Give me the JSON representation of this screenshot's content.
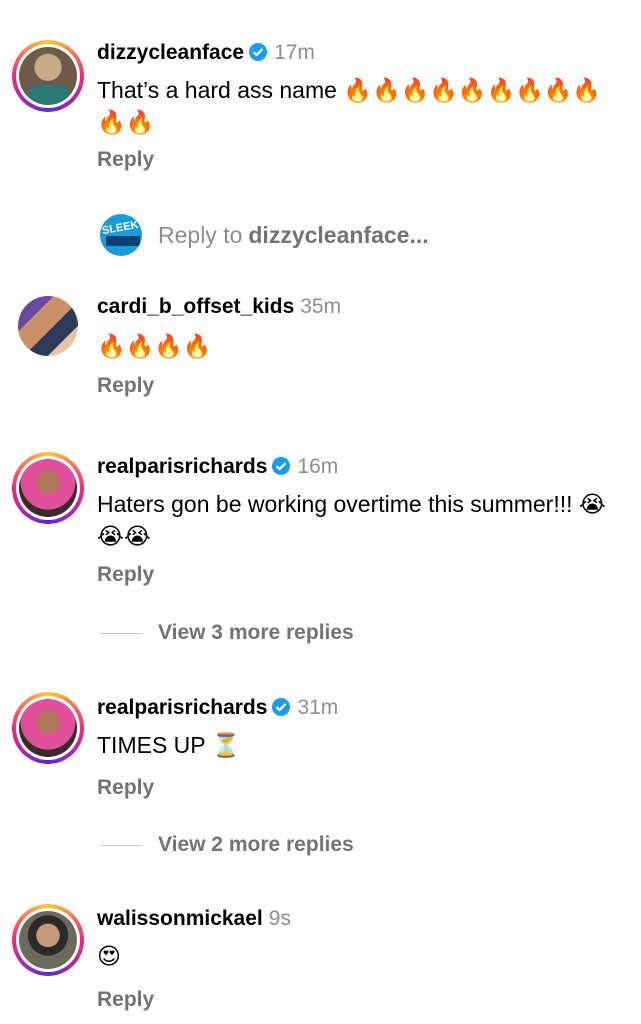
{
  "comments": [
    {
      "username": "dizzycleanface",
      "verified": true,
      "time": "17m",
      "text": "That’s a hard ass name 🔥🔥🔥🔥🔥🔥🔥🔥🔥🔥🔥",
      "reply": "Reply"
    },
    {
      "username": "cardi_b_offset_kids",
      "verified": false,
      "time": "35m",
      "text": "🔥🔥🔥🔥",
      "reply": "Reply"
    },
    {
      "username": "realparisrichards",
      "verified": true,
      "time": "16m",
      "text": "Haters gon be working overtime this summer!!! 😭😭😭",
      "reply": "Reply",
      "more": "View 3 more replies"
    },
    {
      "username": "realparisrichards",
      "verified": true,
      "time": "31m",
      "text": "TIMES UP ⏳",
      "reply": "Reply",
      "more": "View 2 more replies"
    },
    {
      "username": "walissonmickael",
      "verified": false,
      "time": "9s",
      "text": "😍",
      "reply": "Reply"
    }
  ],
  "reply_to": {
    "prefix": "Reply to",
    "username": "dizzycleanface...",
    "avatar_text": "SLEEK JAMAICA MEDIA"
  },
  "colors": {
    "verified": "#1d9bf0",
    "secondary": "#737373",
    "ring_start": "#f9ce34",
    "ring_end": "#ee2a7b"
  }
}
